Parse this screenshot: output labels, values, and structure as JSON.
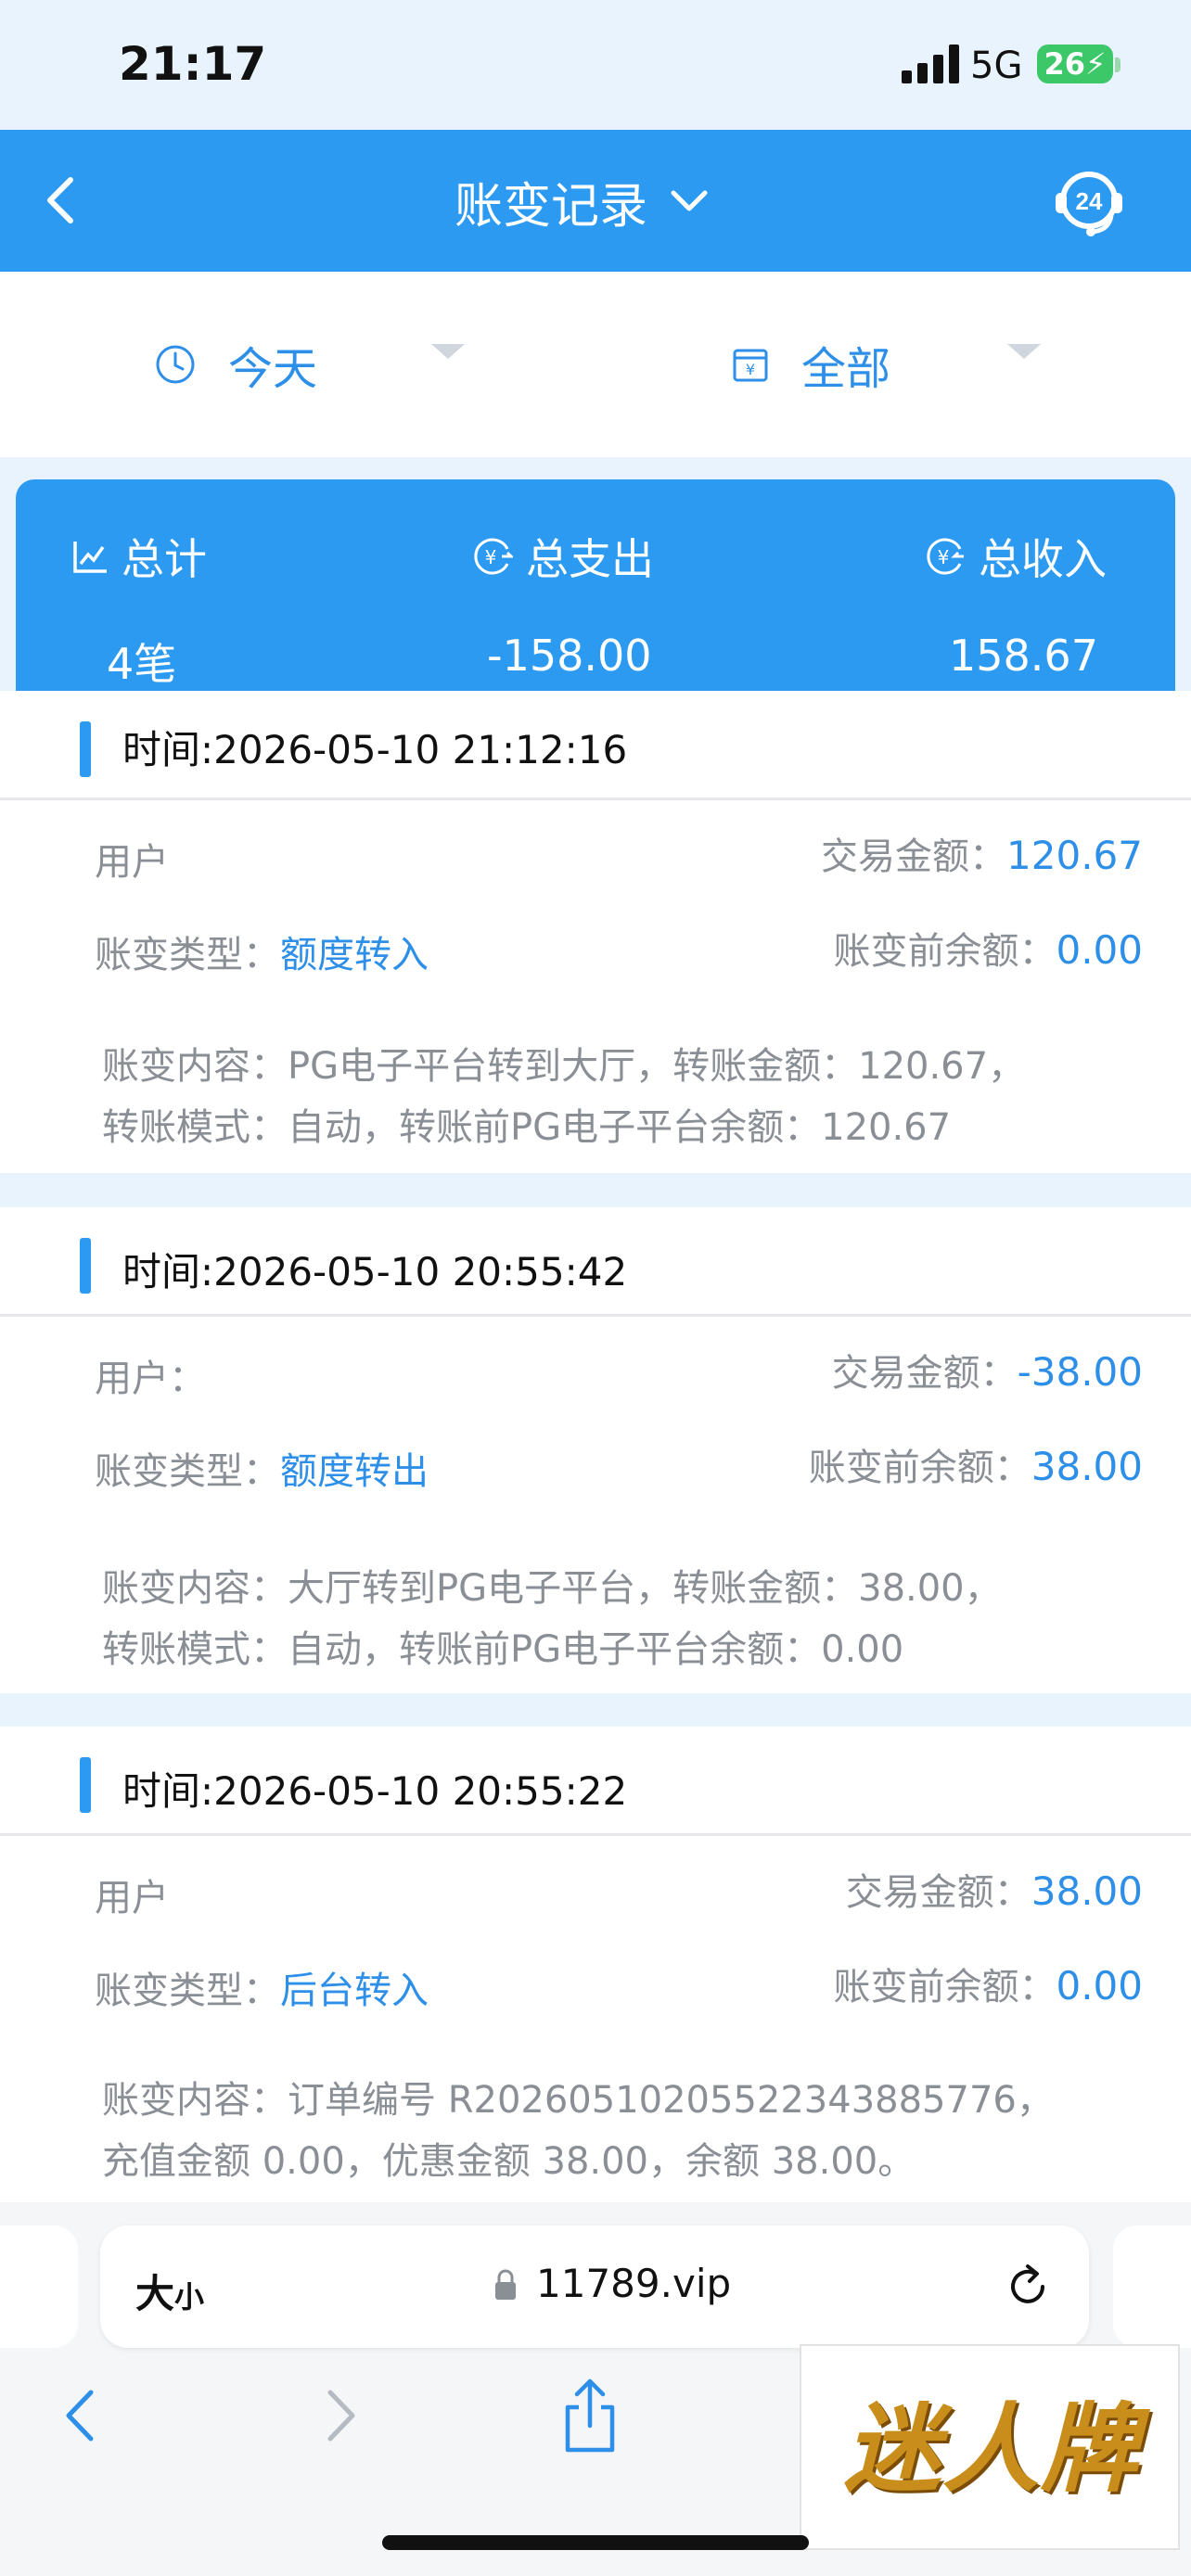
{
  "status_bar": {
    "time": "21:17",
    "network": "5G",
    "battery": "26"
  },
  "nav": {
    "title": "账变记录",
    "service_badge": "24"
  },
  "filters": {
    "date": {
      "label": "今天"
    },
    "type": {
      "label": "全部"
    }
  },
  "summary": {
    "total": {
      "label": "总计",
      "value": "4笔"
    },
    "expense": {
      "label": "总支出",
      "value": "-158.00"
    },
    "income": {
      "label": "总收入",
      "value": "158.67"
    }
  },
  "records": [
    {
      "time": "时间:2026-05-10 21:12:16",
      "user_label": "用户",
      "amount_label": "交易金额：",
      "amount": "120.67",
      "type_label": "账变类型：",
      "type": "额度转入",
      "balance_label": "账变前余额：",
      "balance": "0.00",
      "content_line1": "账变内容：PG电子平台转到大厅，转账金额：120.67，",
      "content_line2": "转账模式：自动，转账前PG电子平台余额：120.67"
    },
    {
      "time": "时间:2026-05-10 20:55:42",
      "user_label": "用户：",
      "amount_label": "交易金额：",
      "amount": "-38.00",
      "type_label": "账变类型：",
      "type": "额度转出",
      "balance_label": "账变前余额：",
      "balance": "38.00",
      "content_line1": "账变内容：大厅转到PG电子平台，转账金额：38.00，",
      "content_line2": "转账模式：自动，转账前PG电子平台余额：0.00"
    },
    {
      "time": "时间:2026-05-10 20:55:22",
      "user_label": "用户",
      "amount_label": "交易金额：",
      "amount": "38.00",
      "type_label": "账变类型：",
      "type": "后台转入",
      "balance_label": "账变前余额：",
      "balance": "0.00",
      "content_line1": "账变内容：订单编号 R20260510205522343885776，",
      "content_line2": "充值金额 0.00，优惠金额 38.00，余额 38.00。"
    }
  ],
  "browser": {
    "text_size_big": "大",
    "text_size_small": "小",
    "url": "11789.vip"
  },
  "watermark": {
    "text": "迷人牌"
  },
  "colors": {
    "primary": "#2d9af2",
    "link": "#2d8fe8",
    "label_gray": "#8a8f96",
    "page_bg": "#e9f3fd"
  }
}
